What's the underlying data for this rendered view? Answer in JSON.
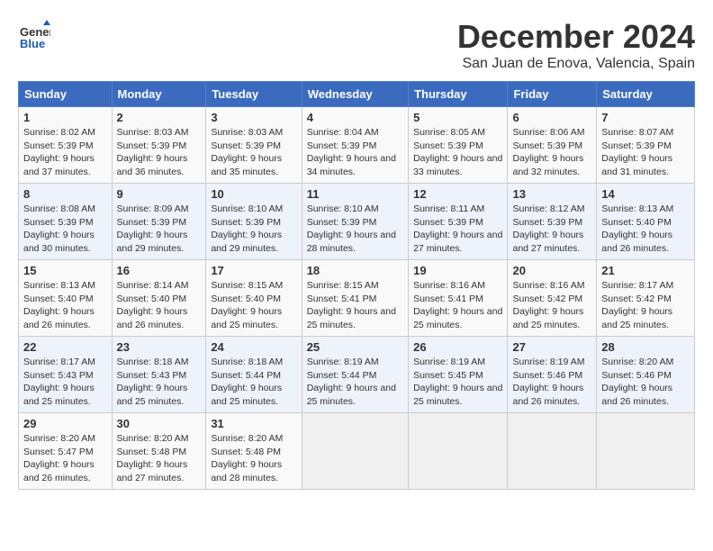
{
  "logo": {
    "line1": "General",
    "line2": "Blue"
  },
  "title": "December 2024",
  "location": "San Juan de Enova, Valencia, Spain",
  "weekdays": [
    "Sunday",
    "Monday",
    "Tuesday",
    "Wednesday",
    "Thursday",
    "Friday",
    "Saturday"
  ],
  "weeks": [
    [
      {
        "day": "1",
        "sunrise": "8:02 AM",
        "sunset": "5:39 PM",
        "daylight": "9 hours and 37 minutes."
      },
      {
        "day": "2",
        "sunrise": "8:03 AM",
        "sunset": "5:39 PM",
        "daylight": "9 hours and 36 minutes."
      },
      {
        "day": "3",
        "sunrise": "8:03 AM",
        "sunset": "5:39 PM",
        "daylight": "9 hours and 35 minutes."
      },
      {
        "day": "4",
        "sunrise": "8:04 AM",
        "sunset": "5:39 PM",
        "daylight": "9 hours and 34 minutes."
      },
      {
        "day": "5",
        "sunrise": "8:05 AM",
        "sunset": "5:39 PM",
        "daylight": "9 hours and 33 minutes."
      },
      {
        "day": "6",
        "sunrise": "8:06 AM",
        "sunset": "5:39 PM",
        "daylight": "9 hours and 32 minutes."
      },
      {
        "day": "7",
        "sunrise": "8:07 AM",
        "sunset": "5:39 PM",
        "daylight": "9 hours and 31 minutes."
      }
    ],
    [
      {
        "day": "8",
        "sunrise": "8:08 AM",
        "sunset": "5:39 PM",
        "daylight": "9 hours and 30 minutes."
      },
      {
        "day": "9",
        "sunrise": "8:09 AM",
        "sunset": "5:39 PM",
        "daylight": "9 hours and 29 minutes."
      },
      {
        "day": "10",
        "sunrise": "8:10 AM",
        "sunset": "5:39 PM",
        "daylight": "9 hours and 29 minutes."
      },
      {
        "day": "11",
        "sunrise": "8:10 AM",
        "sunset": "5:39 PM",
        "daylight": "9 hours and 28 minutes."
      },
      {
        "day": "12",
        "sunrise": "8:11 AM",
        "sunset": "5:39 PM",
        "daylight": "9 hours and 27 minutes."
      },
      {
        "day": "13",
        "sunrise": "8:12 AM",
        "sunset": "5:39 PM",
        "daylight": "9 hours and 27 minutes."
      },
      {
        "day": "14",
        "sunrise": "8:13 AM",
        "sunset": "5:40 PM",
        "daylight": "9 hours and 26 minutes."
      }
    ],
    [
      {
        "day": "15",
        "sunrise": "8:13 AM",
        "sunset": "5:40 PM",
        "daylight": "9 hours and 26 minutes."
      },
      {
        "day": "16",
        "sunrise": "8:14 AM",
        "sunset": "5:40 PM",
        "daylight": "9 hours and 26 minutes."
      },
      {
        "day": "17",
        "sunrise": "8:15 AM",
        "sunset": "5:40 PM",
        "daylight": "9 hours and 25 minutes."
      },
      {
        "day": "18",
        "sunrise": "8:15 AM",
        "sunset": "5:41 PM",
        "daylight": "9 hours and 25 minutes."
      },
      {
        "day": "19",
        "sunrise": "8:16 AM",
        "sunset": "5:41 PM",
        "daylight": "9 hours and 25 minutes."
      },
      {
        "day": "20",
        "sunrise": "8:16 AM",
        "sunset": "5:42 PM",
        "daylight": "9 hours and 25 minutes."
      },
      {
        "day": "21",
        "sunrise": "8:17 AM",
        "sunset": "5:42 PM",
        "daylight": "9 hours and 25 minutes."
      }
    ],
    [
      {
        "day": "22",
        "sunrise": "8:17 AM",
        "sunset": "5:43 PM",
        "daylight": "9 hours and 25 minutes."
      },
      {
        "day": "23",
        "sunrise": "8:18 AM",
        "sunset": "5:43 PM",
        "daylight": "9 hours and 25 minutes."
      },
      {
        "day": "24",
        "sunrise": "8:18 AM",
        "sunset": "5:44 PM",
        "daylight": "9 hours and 25 minutes."
      },
      {
        "day": "25",
        "sunrise": "8:19 AM",
        "sunset": "5:44 PM",
        "daylight": "9 hours and 25 minutes."
      },
      {
        "day": "26",
        "sunrise": "8:19 AM",
        "sunset": "5:45 PM",
        "daylight": "9 hours and 25 minutes."
      },
      {
        "day": "27",
        "sunrise": "8:19 AM",
        "sunset": "5:46 PM",
        "daylight": "9 hours and 26 minutes."
      },
      {
        "day": "28",
        "sunrise": "8:20 AM",
        "sunset": "5:46 PM",
        "daylight": "9 hours and 26 minutes."
      }
    ],
    [
      {
        "day": "29",
        "sunrise": "8:20 AM",
        "sunset": "5:47 PM",
        "daylight": "9 hours and 26 minutes."
      },
      {
        "day": "30",
        "sunrise": "8:20 AM",
        "sunset": "5:48 PM",
        "daylight": "9 hours and 27 minutes."
      },
      {
        "day": "31",
        "sunrise": "8:20 AM",
        "sunset": "5:48 PM",
        "daylight": "9 hours and 28 minutes."
      },
      null,
      null,
      null,
      null
    ]
  ]
}
